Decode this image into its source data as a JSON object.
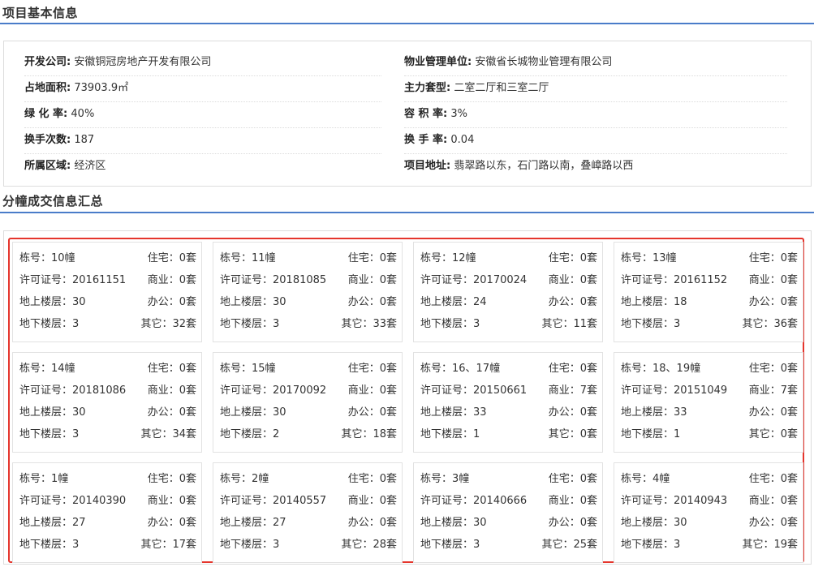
{
  "sections": {
    "basic_info_title": "项目基本信息",
    "units_title": "分幢成交信息汇总"
  },
  "basic_info": {
    "left": [
      {
        "label": "开发公司:",
        "value": "安徽铜冠房地产开发有限公司"
      },
      {
        "label": "占地面积:",
        "value": "73903.9㎡"
      },
      {
        "label": "绿 化 率:",
        "value": "40%"
      },
      {
        "label": "换手次数:",
        "value": "187"
      },
      {
        "label": "所属区域:",
        "value": "经济区"
      }
    ],
    "right": [
      {
        "label": "物业管理单位:",
        "value": "安徽省长城物业管理有限公司"
      },
      {
        "label": "主力套型:",
        "value": "二室二厅和三室二厅"
      },
      {
        "label": "容 积 率:",
        "value": "3%"
      },
      {
        "label": "换 手 率:",
        "value": "0.04"
      },
      {
        "label": "项目地址:",
        "value": "翡翠路以东，石门路以南，叠嶂路以西"
      }
    ]
  },
  "buildings": [
    {
      "building": "栋号：10幢",
      "permit": "许可证号：20161151",
      "above": "地上楼层：30",
      "below": "地下楼层：3",
      "residential": "住宅：0套",
      "commercial": "商业：0套",
      "office": "办公：0套",
      "other": "其它：32套"
    },
    {
      "building": "栋号：11幢",
      "permit": "许可证号：20181085",
      "above": "地上楼层：30",
      "below": "地下楼层：3",
      "residential": "住宅：0套",
      "commercial": "商业：0套",
      "office": "办公：0套",
      "other": "其它：33套"
    },
    {
      "building": "栋号：12幢",
      "permit": "许可证号：20170024",
      "above": "地上楼层：24",
      "below": "地下楼层：3",
      "residential": "住宅：0套",
      "commercial": "商业：0套",
      "office": "办公：0套",
      "other": "其它：11套"
    },
    {
      "building": "栋号：13幢",
      "permit": "许可证号：20161152",
      "above": "地上楼层：18",
      "below": "地下楼层：3",
      "residential": "住宅：0套",
      "commercial": "商业：0套",
      "office": "办公：0套",
      "other": "其它：36套"
    },
    {
      "building": "栋号：14幢",
      "permit": "许可证号：20181086",
      "above": "地上楼层：30",
      "below": "地下楼层：3",
      "residential": "住宅：0套",
      "commercial": "商业：0套",
      "office": "办公：0套",
      "other": "其它：34套"
    },
    {
      "building": "栋号：15幢",
      "permit": "许可证号：20170092",
      "above": "地上楼层：30",
      "below": "地下楼层：2",
      "residential": "住宅：0套",
      "commercial": "商业：0套",
      "office": "办公：0套",
      "other": "其它：18套"
    },
    {
      "building": "栋号：16、17幢",
      "permit": "许可证号：20150661",
      "above": "地上楼层：33",
      "below": "地下楼层：1",
      "residential": "住宅：0套",
      "commercial": "商业：7套",
      "office": "办公：0套",
      "other": "其它：0套"
    },
    {
      "building": "栋号：18、19幢",
      "permit": "许可证号：20151049",
      "above": "地上楼层：33",
      "below": "地下楼层：1",
      "residential": "住宅：0套",
      "commercial": "商业：7套",
      "office": "办公：0套",
      "other": "其它：0套"
    },
    {
      "building": "栋号：1幢",
      "permit": "许可证号：20140390",
      "above": "地上楼层：27",
      "below": "地下楼层：3",
      "residential": "住宅：0套",
      "commercial": "商业：0套",
      "office": "办公：0套",
      "other": "其它：17套"
    },
    {
      "building": "栋号：2幢",
      "permit": "许可证号：20140557",
      "above": "地上楼层：27",
      "below": "地下楼层：3",
      "residential": "住宅：0套",
      "commercial": "商业：0套",
      "office": "办公：0套",
      "other": "其它：28套"
    },
    {
      "building": "栋号：3幢",
      "permit": "许可证号：20140666",
      "above": "地上楼层：30",
      "below": "地下楼层：3",
      "residential": "住宅：0套",
      "commercial": "商业：0套",
      "office": "办公：0套",
      "other": "其它：25套"
    },
    {
      "building": "栋号：4幢",
      "permit": "许可证号：20140943",
      "above": "地上楼层：30",
      "below": "地下楼层：3",
      "residential": "住宅：0套",
      "commercial": "商业：0套",
      "office": "办公：0套",
      "other": "其它：19套"
    }
  ],
  "colors": {
    "accent_line": "#4a7cc9",
    "highlight_frame": "#e5352c"
  }
}
